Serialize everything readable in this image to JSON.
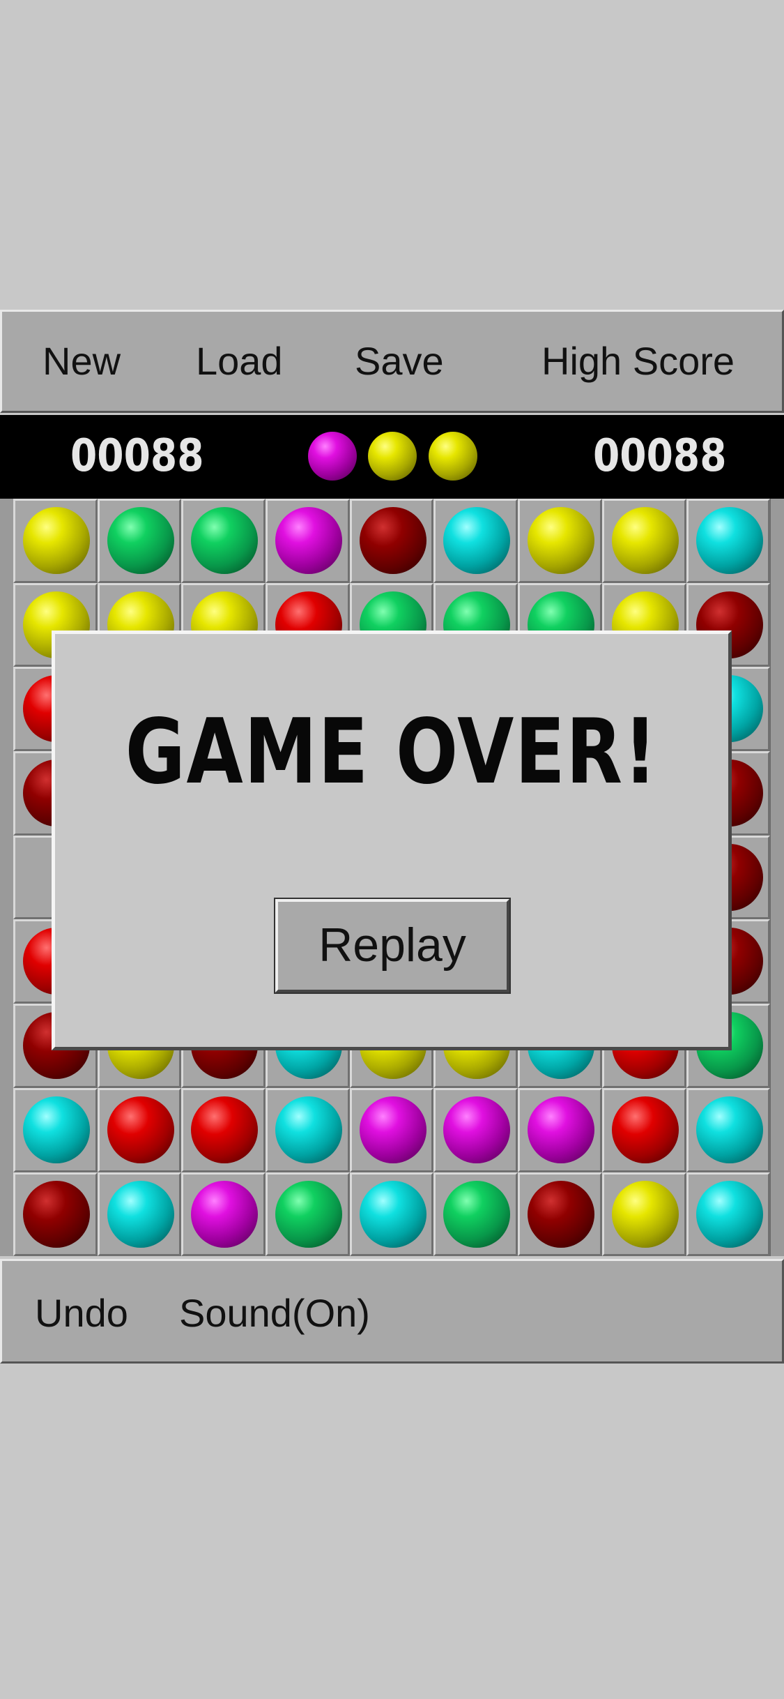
{
  "menu": {
    "new_label": "New",
    "load_label": "Load",
    "save_label": "Save",
    "highscore_label": "High Score"
  },
  "scorebar": {
    "score": "00088",
    "high_score": "00088",
    "next_balls": [
      "magenta",
      "yellow",
      "yellow"
    ]
  },
  "board": {
    "rows": [
      [
        "yellow",
        "green",
        "green",
        "magenta",
        "dred",
        "cyan",
        "yellow",
        "yellow",
        "cyan"
      ],
      [
        "yellow",
        "yellow",
        "yellow",
        "red",
        "green",
        "green",
        "green",
        "yellow",
        "dred"
      ],
      [
        "red",
        "empty",
        "empty",
        "empty",
        "empty",
        "empty",
        "empty",
        "empty",
        "cyan"
      ],
      [
        "dred",
        "empty",
        "empty",
        "empty",
        "empty",
        "empty",
        "empty",
        "empty",
        "dred"
      ],
      [
        "empty",
        "empty",
        "empty",
        "empty",
        "empty",
        "empty",
        "empty",
        "empty",
        "dred"
      ],
      [
        "red",
        "empty",
        "empty",
        "empty",
        "empty",
        "empty",
        "empty",
        "empty",
        "dred"
      ],
      [
        "dred",
        "yellow",
        "dred",
        "cyan",
        "yellow",
        "yellow",
        "cyan",
        "red",
        "green"
      ],
      [
        "cyan",
        "red",
        "red",
        "cyan",
        "magenta",
        "magenta",
        "magenta",
        "red",
        "cyan"
      ],
      [
        "dred",
        "cyan",
        "magenta",
        "green",
        "cyan",
        "green",
        "dred",
        "yellow",
        "cyan"
      ]
    ]
  },
  "bottom": {
    "undo_label": "Undo",
    "sound_label": "Sound(On)"
  },
  "dialog": {
    "title": "GAME OVER!",
    "replay_label": "Replay"
  }
}
